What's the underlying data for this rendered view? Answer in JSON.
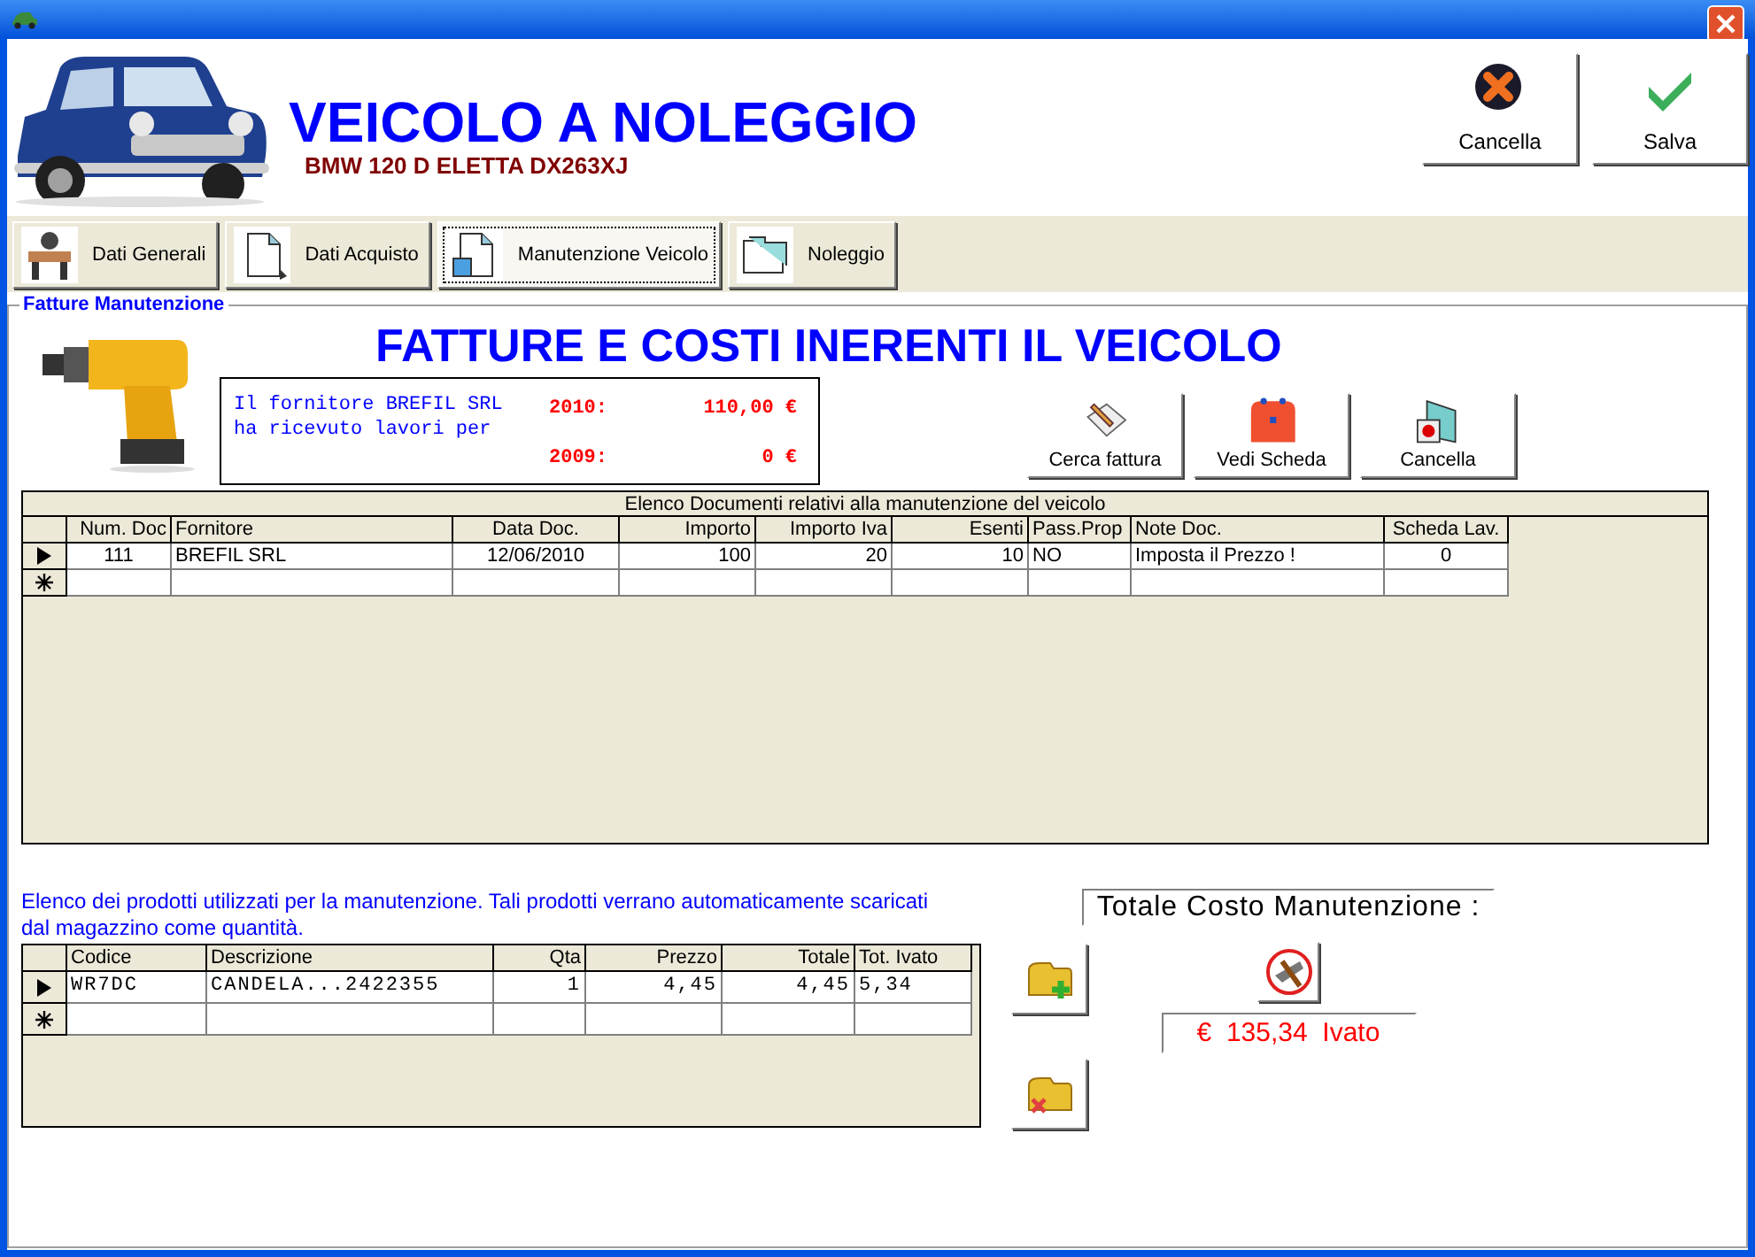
{
  "header": {
    "title": "VEICOLO A NOLEGGIO",
    "subtitle": "BMW 120 D ELETTA DX263XJ"
  },
  "actions": [
    {
      "label": "Cancella",
      "kind": "cancel"
    },
    {
      "label": "Salva",
      "kind": "save"
    }
  ],
  "tabs": [
    {
      "label": "Dati Generali",
      "selected": false,
      "kind": "desk"
    },
    {
      "label": "Dati Acquisto",
      "selected": false,
      "kind": "document"
    },
    {
      "label": "Manutenzione Veicolo",
      "selected": true,
      "kind": "document-tools"
    },
    {
      "label": "Noleggio",
      "selected": false,
      "kind": "folder"
    }
  ],
  "section": {
    "legend": "Fatture Manutenzione",
    "heading": "FATTURE E COSTI INERENTI IL VEICOLO",
    "supplier_info": {
      "lines": [
        "Il fornitore BREFIL SRL",
        "ha ricevuto lavori per"
      ],
      "years": [
        {
          "label": "2010:",
          "amount": "110,00 €"
        },
        {
          "label": "2009:",
          "amount": "0 €"
        }
      ]
    },
    "buttons": [
      {
        "label": "Cerca fattura",
        "kind": "search"
      },
      {
        "label": "Vedi Scheda",
        "kind": "toolbox"
      },
      {
        "label": "Cancella",
        "kind": "delete"
      }
    ]
  },
  "documents_table": {
    "caption": "Elenco Documenti relativi alla manutenzione del veicolo",
    "columns": [
      "Num. Doc",
      "Fornitore",
      "Data Doc.",
      "Importo",
      "Importo Iva",
      "Esenti",
      "Pass.Prop",
      "Note Doc.",
      "Scheda Lav."
    ],
    "rows": [
      {
        "kind": "current",
        "cells": [
          "111",
          "BREFIL SRL",
          "12/06/2010",
          "100",
          "20",
          "10",
          "NO",
          "Imposta il Prezzo !",
          "0"
        ]
      },
      {
        "kind": "new",
        "cells": []
      }
    ]
  },
  "products_note": "Elenco dei prodotti utilizzati per la manutenzione. Tali prodotti verrano automaticamente scaricati dal magazzino come quantità.",
  "products_table": {
    "columns": [
      "Codice",
      "Descrizione",
      "Qta",
      "Prezzo",
      "Totale",
      "Tot. Ivato"
    ],
    "rows": [
      {
        "kind": "current",
        "cells": [
          "WR7DC",
          "CANDELA...2422355",
          "1",
          "4,45",
          "4,45",
          "5,34"
        ]
      },
      {
        "kind": "new",
        "cells": []
      }
    ]
  },
  "product_buttons": [
    {
      "kind": "add"
    },
    {
      "kind": "remove"
    }
  ],
  "total": {
    "label": "Totale Costo Manutenzione :",
    "value": "€  135,34  Ivato"
  }
}
